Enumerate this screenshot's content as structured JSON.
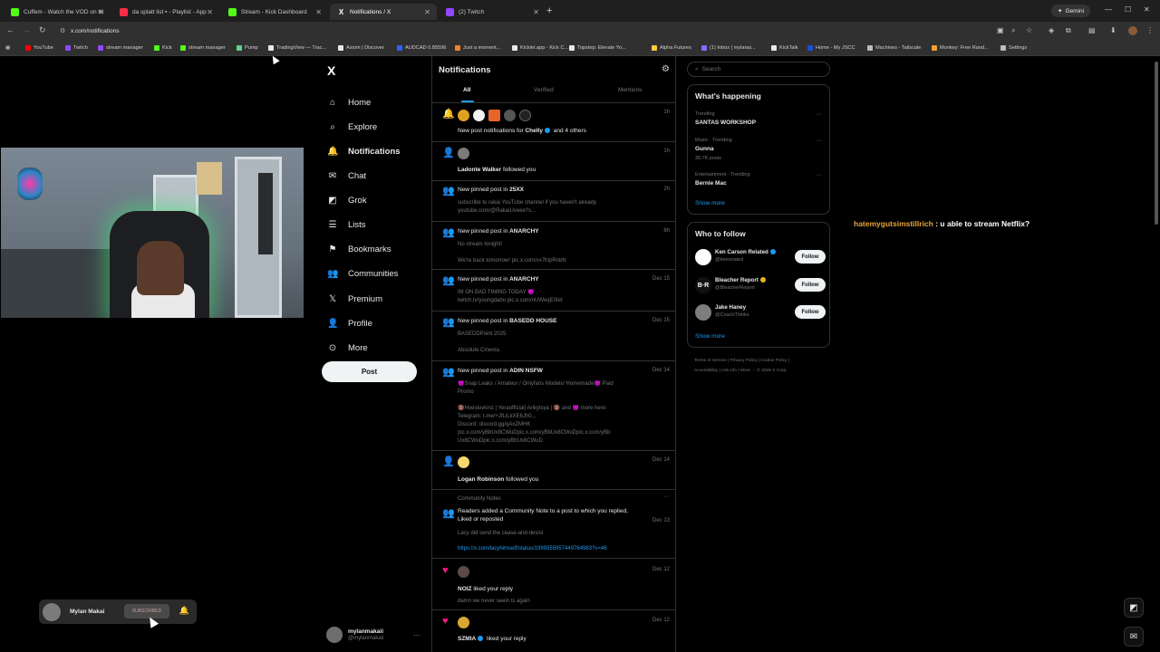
{
  "browser": {
    "tabs": [
      {
        "label": "Cuffem - Watch the VOD on Ki",
        "color": "#53fc18"
      },
      {
        "label": "da splatt list ▪ - Playlist - App",
        "color": "#fa2d48"
      },
      {
        "label": "Stream - Kick Dashboard",
        "color": "#53fc18"
      },
      {
        "label": "Notifications / X",
        "color": "#ffffff"
      },
      {
        "label": "(2) Twitch",
        "color": "#9146ff"
      }
    ],
    "gemini_label": "Gemini",
    "url": "x.com/notifications",
    "bookmarks": [
      {
        "label": "YouTube",
        "color": "#ff0000"
      },
      {
        "label": "Twitch",
        "color": "#9146ff"
      },
      {
        "label": "stream manager",
        "color": "#9146ff"
      },
      {
        "label": "Kick",
        "color": "#53fc18"
      },
      {
        "label": "stream manager",
        "color": "#53fc18"
      },
      {
        "label": "Pump",
        "color": "#5fd38d"
      },
      {
        "label": "TradingView — Trac...",
        "color": "#e8e8e8"
      },
      {
        "label": "Axiom | Discover",
        "color": "#e8e8e8"
      },
      {
        "label": "AUDCAD 0.85596",
        "color": "#2962ff"
      },
      {
        "label": "Just a moment...",
        "color": "#f48120"
      },
      {
        "label": "Kicklet.app - Kick C...",
        "color": "#e8e8e8"
      },
      {
        "label": "Topstep: Elevate Yo...",
        "color": "#e8e8e8"
      },
      {
        "label": "Alpha Futures",
        "color": "#ffc83d"
      },
      {
        "label": "(1) Inbox | mylanai...",
        "color": "#8f67ff"
      },
      {
        "label": "KickTalk",
        "color": "#e8e8e8"
      },
      {
        "label": "Home - My JSCC",
        "color": "#1d4ed8"
      },
      {
        "label": "Machines - Tailscale",
        "color": "#bbbbbb"
      },
      {
        "label": "Monkey: Free Rand...",
        "color": "#f0a030"
      },
      {
        "label": "Settings",
        "color": "#bbbbbb"
      }
    ]
  },
  "x_nav": {
    "logo": "X",
    "items": [
      {
        "label": "Home",
        "icon": "home-icon",
        "glyph": "⌂"
      },
      {
        "label": "Explore",
        "icon": "search-icon",
        "glyph": "⌕"
      },
      {
        "label": "Notifications",
        "icon": "bell-icon",
        "glyph": "🔔"
      },
      {
        "label": "Chat",
        "icon": "chat-icon",
        "glyph": "✉"
      },
      {
        "label": "Grok",
        "icon": "grok-icon",
        "glyph": "◩"
      },
      {
        "label": "Lists",
        "icon": "lists-icon",
        "glyph": "☰"
      },
      {
        "label": "Bookmarks",
        "icon": "bookmark-icon",
        "glyph": "⚑"
      },
      {
        "label": "Communities",
        "icon": "communities-icon",
        "glyph": "👥"
      },
      {
        "label": "Premium",
        "icon": "premium-icon",
        "glyph": "𝕏"
      },
      {
        "label": "Profile",
        "icon": "profile-icon",
        "glyph": "👤"
      },
      {
        "label": "More",
        "icon": "more-icon",
        "glyph": "⊙"
      }
    ],
    "post_label": "Post",
    "account_name": "mylanmakaii",
    "account_handle": "@mylanmakaii"
  },
  "feed": {
    "title": "Notifications",
    "tabs": [
      "All",
      "Verified",
      "Mentions"
    ],
    "n1": {
      "time": "1h",
      "pre": "New post notifications for ",
      "name": "Chelly",
      "post": " and 4 others"
    },
    "n2": {
      "time": "1h",
      "name": "Ladonte Walker",
      "post": " followed you"
    },
    "n3": {
      "time": "2h",
      "pre": "New pinned post in ",
      "name": "25XX",
      "sub1": "subscribe to rakai YouTube channel if you haven't already",
      "sub2": "youtube.com/@RakaiUveee?s..."
    },
    "n4": {
      "time": "6h",
      "pre": "New pinned post in ",
      "name": "ANARCHY",
      "sub1": "No stream tonight!",
      "sub2": "We're back tomorrow! pic.x.com/vx7hIpRnbN"
    },
    "n5": {
      "time": "Dec 15",
      "pre": "New pinned post in ",
      "name": "ANARCHY",
      "sub1": "IM ON BAD TIMING TODAY 😈",
      "sub2": "twitch.tv/youngdabo pic.x.com/nUWeqE0tet"
    },
    "n6": {
      "time": "Dec 15",
      "pre": "New pinned post in ",
      "name": "BASEDD HOUSE",
      "sub1": "BASEDDPoint 2025",
      "sub2": "Absolute Cinema."
    },
    "n7": {
      "time": "Dec 14",
      "pre": "New pinned post in ",
      "name": "ADIN NSFW",
      "sub1": "😈Snap Leaks / Amateur / Onlyfans Models/ Homemade😈 Paid",
      "sub2": "Promo",
      "sub3": "🔞Hoesluvkinz | Yeraofficial| Arikytsya | 🔞 and 😈 more here:",
      "sub4": "Telegram: t.me/+JfLiLkXE6Jh0...",
      "sub5": "Discord: discord.gg/qAxZMHK",
      "sub6": "pic.x.com/yBbUx8CWuDpic.x.com/yBbUx8CWuDpic.x.com/yBb",
      "sub7": "Ux8CWuDpic.x.com/yBbUx8CWuD"
    },
    "n8": {
      "time": "Dec 14",
      "name": "Logan Robinson",
      "post": " followed you"
    },
    "n9": {
      "label": "Community Notes",
      "time": "Dec 13",
      "text1": "Readers added a Community Note to a post to which you replied,",
      "text2": "Liked or reposted",
      "sub1": "Lacy did send the cease-and-desist",
      "link": "https://x.com/lacyhimself/status/1999355957449764983?s=46"
    },
    "n10": {
      "time": "Dec 12",
      "name": "NOIZ",
      "post": " liked your reply",
      "sub1": "damn we never seein ts again"
    },
    "n11": {
      "time": "Dec 12",
      "name": "SZMIA",
      "post": " liked your reply"
    }
  },
  "right": {
    "search_placeholder": "Search",
    "happening_title": "What's happening",
    "trends": [
      {
        "meta": "Trending",
        "name": "SANTAS WORKSHOP",
        "count": ""
      },
      {
        "meta": "Music · Trending",
        "name": "Gunna",
        "count": "30.7K posts"
      },
      {
        "meta": "Entertainment · Trending",
        "name": "Bernie Mac",
        "count": ""
      }
    ],
    "show_more": "Show more",
    "who_title": "Who to follow",
    "who": [
      {
        "name": "Ken Carson Related",
        "handle": "@kenrelated",
        "color": "#ffffff"
      },
      {
        "name": "Bleacher Report",
        "handle": "@BleacherReport",
        "color": "#111111"
      },
      {
        "name": "Jake Haney",
        "handle": "@CoachThinks",
        "color": "#7d7d7d"
      }
    ],
    "follow_label": "Follow",
    "footer1": "Terms of Service  |  Privacy Policy  |  Cookie Policy  |",
    "footer2": "Accessibility  |  Ads info  |  More ···  © 2025 X Corp."
  },
  "chat": {
    "user": "hatemygutsimstillrich",
    "message": " : u able to stream Netflix?"
  },
  "overlay": {
    "name": "Mylan Makai",
    "sub_label": "SUBSCRIBED"
  }
}
